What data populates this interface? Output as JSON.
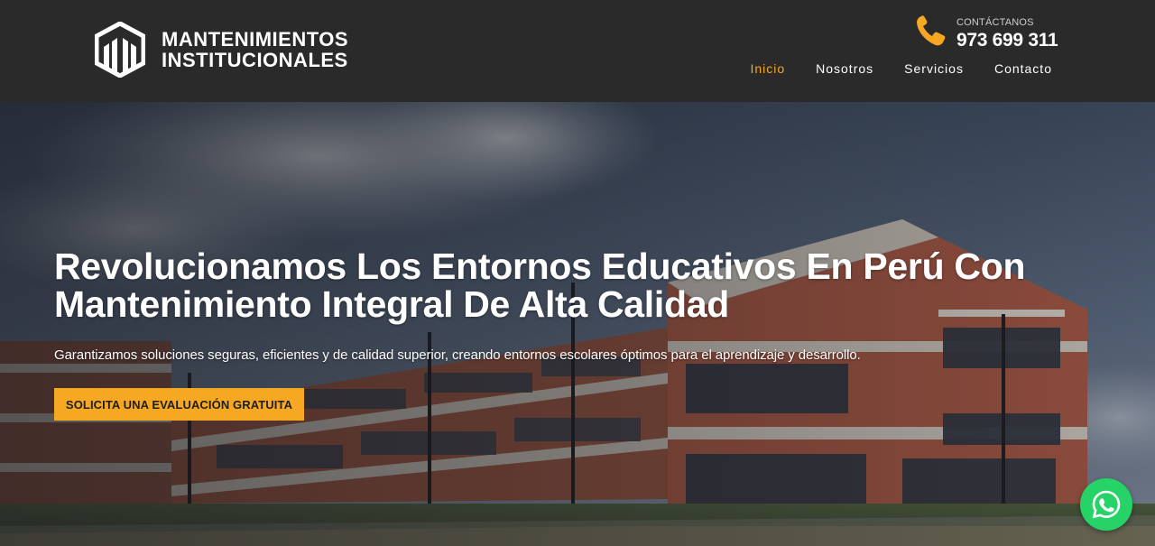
{
  "brand": {
    "line1": "MANTENIMIENTOS",
    "line2": "INSTITUCIONALES",
    "logo_icon": "building-shield-icon"
  },
  "contact": {
    "label": "CONTÁCTANOS",
    "phone": "973 699 311",
    "icon": "phone-icon"
  },
  "nav": {
    "items": [
      {
        "label": "Inicio",
        "active": true
      },
      {
        "label": "Nosotros",
        "active": false
      },
      {
        "label": "Servicios",
        "active": false
      },
      {
        "label": "Contacto",
        "active": false
      }
    ]
  },
  "hero": {
    "headline_line1": "Revolucionamos Los Entornos Educativos En Perú Con",
    "headline_line2": "Mantenimiento Integral De Alta Calidad",
    "subtext": "Garantizamos soluciones seguras, eficientes y de calidad superior, creando entornos escolares óptimos para el aprendizaje y desarrollo.",
    "cta_label": "SOLICITA UNA EVALUACIÓN GRATUITA"
  },
  "floating": {
    "whatsapp_icon": "whatsapp-icon"
  },
  "colors": {
    "accent": "#f5a623",
    "header_bg": "#2a2a2a",
    "cta_bg": "#f7a823",
    "whatsapp": "#25d366"
  }
}
